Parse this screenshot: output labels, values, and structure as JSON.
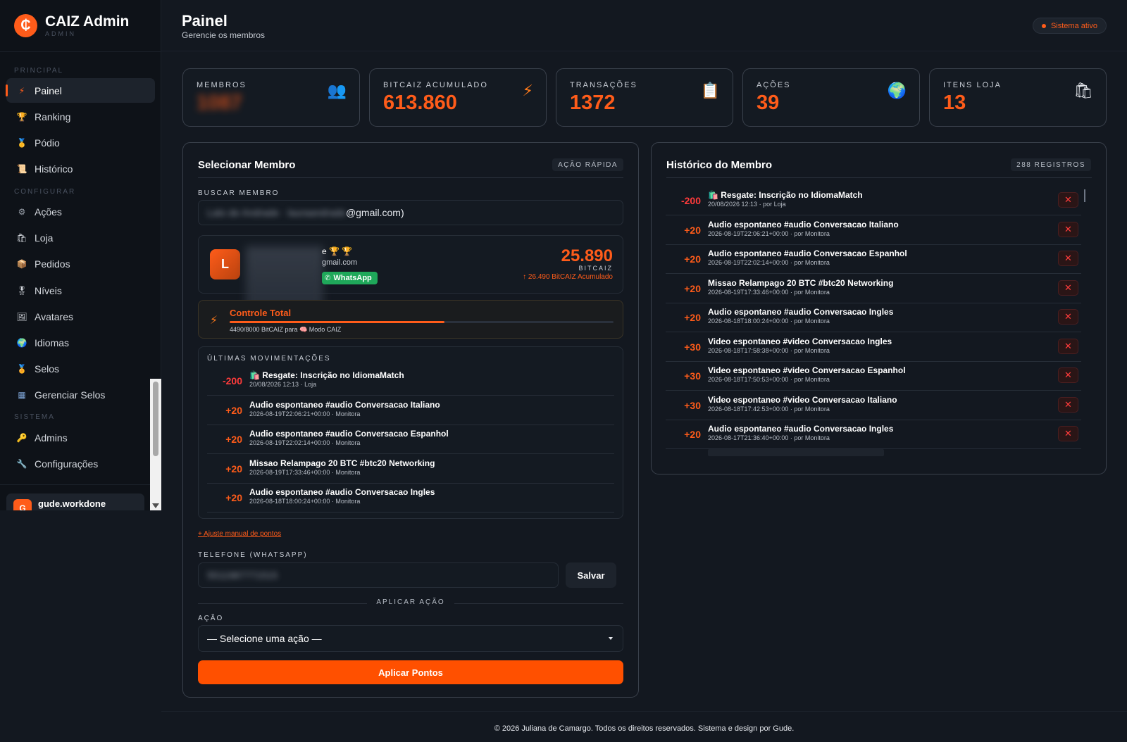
{
  "sidebar": {
    "brand_title": "CAIZ Admin",
    "brand_sub": "ADMIN",
    "sections": {
      "principal": "PRINCIPAL",
      "configurar": "CONFIGURAR",
      "sistema": "SISTEMA"
    },
    "items": [
      {
        "label": "Painel",
        "icon": "lightning-icon"
      },
      {
        "label": "Ranking",
        "icon": "trophy-icon"
      },
      {
        "label": "Pódio",
        "icon": "medal-icon"
      },
      {
        "label": "Histórico",
        "icon": "scroll-icon"
      },
      {
        "label": "Ações",
        "icon": "gear-icon"
      },
      {
        "label": "Loja",
        "icon": "shopping-bags-icon"
      },
      {
        "label": "Pedidos",
        "icon": "package-icon"
      },
      {
        "label": "Níveis",
        "icon": "medal-ribbon-icon"
      },
      {
        "label": "Avatares",
        "icon": "picture-icon"
      },
      {
        "label": "Idiomas",
        "icon": "globe-icon"
      },
      {
        "label": "Selos",
        "icon": "badge-icon"
      },
      {
        "label": "Gerenciar Selos",
        "icon": "grid-icon"
      },
      {
        "label": "Admins",
        "icon": "key-icon"
      },
      {
        "label": "Configurações",
        "icon": "wrench-icon"
      }
    ],
    "user": {
      "initial": "G",
      "name": "gude.workdone"
    }
  },
  "header": {
    "title": "Painel",
    "subtitle": "Gerencie os membros",
    "status": "Sistema ativo"
  },
  "stats": [
    {
      "label": "MEMBROS",
      "value": "1087",
      "icon": "people-icon"
    },
    {
      "label": "BITCAIZ ACUMULADO",
      "value": "613.860",
      "icon": "lightning-icon"
    },
    {
      "label": "TRANSAÇÕES",
      "value": "1372",
      "icon": "clipboard-icon"
    },
    {
      "label": "AÇÕES",
      "value": "39",
      "icon": "globe-icon"
    },
    {
      "label": "ITENS LOJA",
      "value": "13",
      "icon": "shopping-bags-icon"
    }
  ],
  "select_member": {
    "title": "Selecionar Membro",
    "badge": "AÇÃO RÁPIDA",
    "search_label": "BUSCAR MEMBRO",
    "search_value_hidden": "Lalo de Andrade · lauraandrade",
    "search_value_suffix": "@gmail.com)",
    "member": {
      "initial": "L",
      "trophies": "e 🏆 🏆",
      "email_suffix": "gmail.com",
      "whatsapp_label": "WhatsApp",
      "points": "25.890",
      "points_unit": "BITCAIZ",
      "accumulated": "↑ 26.490 BitCAIZ Acumulado"
    },
    "progress": {
      "title": "Controle Total",
      "caption": "4490/8000 BitCAIZ para 🧠 Modo CAIZ",
      "fraction": 0.56
    },
    "movements_label": "ÚLTIMAS MOVIMENTAÇÕES",
    "movements": [
      {
        "amount": "-200",
        "title": "🛍️ Resgate: Inscrição no IdiomaMatch",
        "sub": "20/08/2026 12:13 · Loja"
      },
      {
        "amount": "+20",
        "title": "Audio espontaneo #audio Conversacao Italiano",
        "sub": "2026-08-19T22:06:21+00:00 · Monitora"
      },
      {
        "amount": "+20",
        "title": "Audio espontaneo #audio Conversacao Espanhol",
        "sub": "2026-08-19T22:02:14+00:00 · Monitora"
      },
      {
        "amount": "+20",
        "title": "Missao Relampago 20 BTC #btc20 Networking",
        "sub": "2026-08-19T17:33:46+00:00 · Monitora"
      },
      {
        "amount": "+20",
        "title": "Audio espontaneo #audio Conversacao Ingles",
        "sub": "2026-08-18T18:00:24+00:00 · Monitora"
      }
    ],
    "manual_adjust": "+ Ajuste manual de pontos",
    "phone_label": "TELEFONE (WHATSAPP)",
    "phone_value": "5511987771515",
    "save_label": "Salvar",
    "apply_section": "APLICAR AÇÃO",
    "action_label": "AÇÃO",
    "action_value": "— Selecione uma ação —",
    "apply_button": "Aplicar Pontos"
  },
  "history": {
    "title": "Histórico do Membro",
    "badge": "288 REGISTROS",
    "items": [
      {
        "amount": "-200",
        "title": "🛍️ Resgate: Inscrição no IdiomaMatch",
        "sub": "20/08/2026 12:13 · por Loja"
      },
      {
        "amount": "+20",
        "title": "Audio espontaneo #audio Conversacao Italiano",
        "sub": "2026-08-19T22:06:21+00:00 · por Monitora"
      },
      {
        "amount": "+20",
        "title": "Audio espontaneo #audio Conversacao Espanhol",
        "sub": "2026-08-19T22:02:14+00:00 · por Monitora"
      },
      {
        "amount": "+20",
        "title": "Missao Relampago 20 BTC #btc20 Networking",
        "sub": "2026-08-19T17:33:46+00:00 · por Monitora"
      },
      {
        "amount": "+20",
        "title": "Audio espontaneo #audio Conversacao Ingles",
        "sub": "2026-08-18T18:00:24+00:00 · por Monitora"
      },
      {
        "amount": "+30",
        "title": "Video espontaneo #video Conversacao Ingles",
        "sub": "2026-08-18T17:58:38+00:00 · por Monitora"
      },
      {
        "amount": "+30",
        "title": "Video espontaneo #video Conversacao Espanhol",
        "sub": "2026-08-18T17:50:53+00:00 · por Monitora"
      },
      {
        "amount": "+30",
        "title": "Video espontaneo #video Conversacao Italiano",
        "sub": "2026-08-18T17:42:53+00:00 · por Monitora"
      },
      {
        "amount": "+20",
        "title": "Audio espontaneo #audio Conversacao Ingles",
        "sub": "2026-08-17T21:36:40+00:00 · por Monitora"
      }
    ],
    "delete_symbol": "✕"
  },
  "footer": "© 2026 Juliana de Camargo. Todos os direitos reservados. Sistema e design por Gude."
}
